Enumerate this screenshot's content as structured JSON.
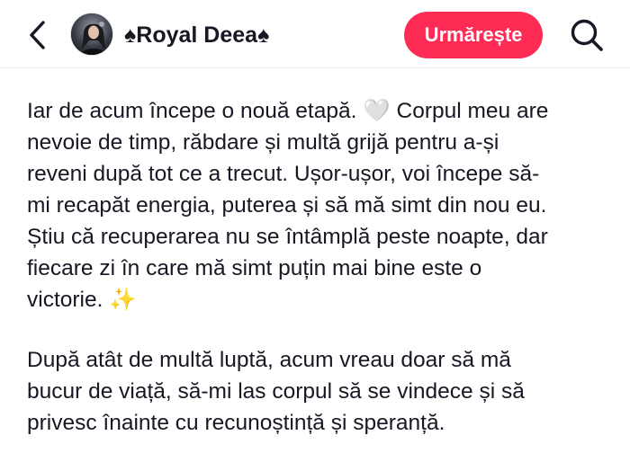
{
  "header": {
    "back_icon": "chevron-left-icon",
    "username": "♠Royal Deea♠",
    "follow_label": "Urmărește",
    "search_icon": "search-icon",
    "accent_color": "#fe2c55"
  },
  "post": {
    "paragraphs": [
      {
        "lines": [
          "Iar de acum începe o nouă etapă. 🤍 Corpul meu are",
          "nevoie de timp, răbdare și multă grijă pentru a-și",
          "reveni după tot ce a trecut. Ușor-ușor, voi începe să-",
          "mi recapăt energia, puterea și să mă simt din nou eu.",
          "Știu că recuperarea nu se întâmplă peste noapte, dar",
          "fiecare zi în care mă simt puțin mai bine este o",
          "victorie. ✨"
        ]
      },
      {
        "lines": [
          "După atât de multă luptă, acum vreau doar să mă",
          "bucur de viață, să-mi las corpul să se vindece și să",
          "privesc înainte cu recunoștință și speranță."
        ]
      }
    ]
  }
}
